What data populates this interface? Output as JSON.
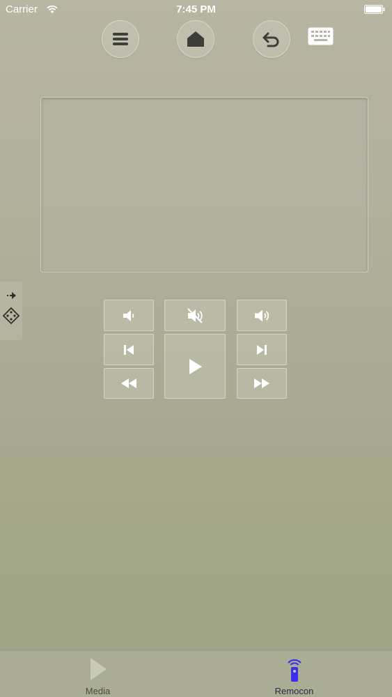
{
  "status_bar": {
    "carrier": "Carrier",
    "time": "7:45 PM"
  },
  "toolbar": {
    "menu_icon": "menu-icon",
    "home_icon": "home-icon",
    "back_icon": "back-icon",
    "keyboard_icon": "keyboard-icon"
  },
  "controls": {
    "icons": [
      "volume-down-icon",
      "mute-icon",
      "volume-up-icon",
      "previous-icon",
      "play-icon",
      "next-icon",
      "rewind-icon",
      "fast-forward-icon"
    ]
  },
  "tabs": [
    {
      "label": "Media",
      "icon": "play-triangle-icon"
    },
    {
      "label": "Remocon",
      "icon": "remote-icon",
      "active_color": "#3a2ff0"
    }
  ]
}
